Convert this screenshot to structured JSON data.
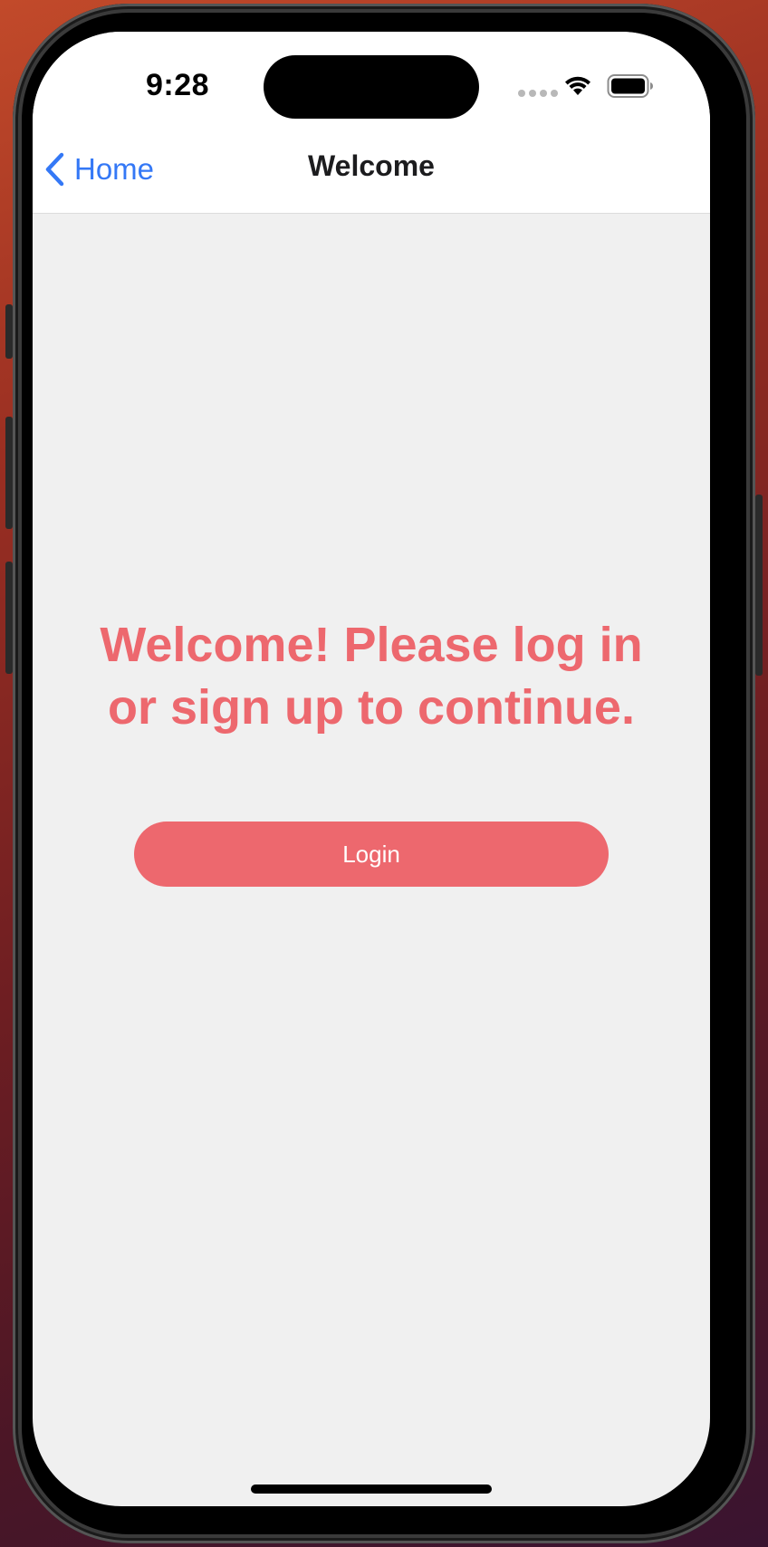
{
  "status_bar": {
    "time": "9:28"
  },
  "nav": {
    "back_label": "Home",
    "title": "Welcome"
  },
  "main": {
    "message": "Welcome! Please log in or sign up to continue.",
    "login_label": "Login"
  },
  "colors": {
    "accent": "#ed686e",
    "link": "#3478f6",
    "background": "#f0f0f0"
  },
  "icons": [
    "wifi-icon",
    "battery-icon",
    "chevron-left-icon"
  ]
}
